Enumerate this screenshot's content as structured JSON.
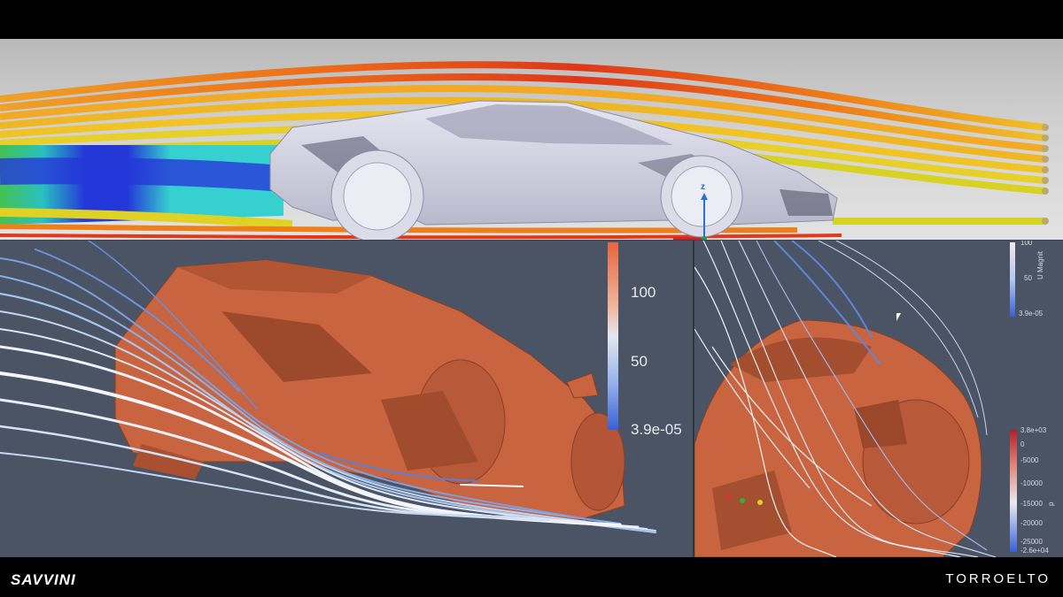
{
  "brand": {
    "left": "SAVVINI",
    "right": "TORROELTO"
  },
  "colors": {
    "panel_bg": "#4a5465",
    "car_body": "#c8643f",
    "streamline": "#a9c4ea",
    "flow_hot": "#d93a1a",
    "flow_cold": "#1b2fd8"
  },
  "top_view": {
    "axis_label": "z"
  },
  "velocity_colorbar": {
    "ticks": [
      "100",
      "50",
      "3.9e-05"
    ]
  },
  "right_view": {
    "velocity_colorbar": {
      "title": "U Magnit",
      "ticks": [
        "100",
        "50",
        "3.9e-05"
      ]
    },
    "pressure_colorbar": {
      "title": "p",
      "ticks": [
        "3.8e+03",
        "0",
        "-5000",
        "-10000",
        "-15000",
        "-20000",
        "-25000",
        "-2.6e+04"
      ]
    }
  },
  "icons": [
    "cursor-icon",
    "axis-triad-icon"
  ]
}
